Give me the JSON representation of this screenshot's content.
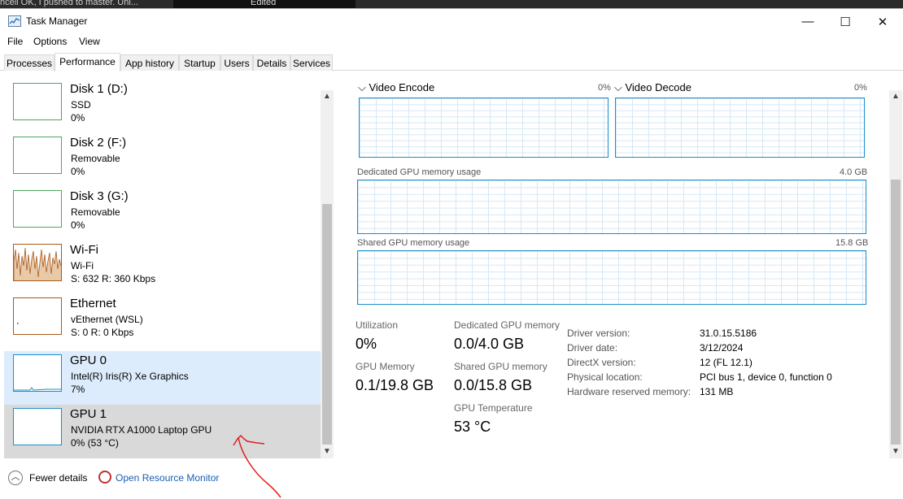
{
  "topstrip": {
    "text": "ncell OK, I pushed to master. Uni..."
  },
  "window": {
    "title": "Task Manager",
    "min": "—",
    "max": "☐",
    "close": "✕"
  },
  "menu": [
    "File",
    "Options",
    "View"
  ],
  "tabs": [
    "Processes",
    "Performance",
    "App history",
    "Startup",
    "Users",
    "Details",
    "Services"
  ],
  "sidebar": [
    {
      "name": "Disk 1 (D:)",
      "sub1": "SSD",
      "sub2": "0%"
    },
    {
      "name": "Disk 2 (F:)",
      "sub1": "Removable",
      "sub2": "0%"
    },
    {
      "name": "Disk 3 (G:)",
      "sub1": "Removable",
      "sub2": "0%"
    },
    {
      "name": "Wi-Fi",
      "sub1": "Wi-Fi",
      "sub2": "S: 632  R: 360 Kbps"
    },
    {
      "name": "Ethernet",
      "sub1": "vEthernet (WSL)",
      "sub2": "S: 0  R: 0 Kbps"
    },
    {
      "name": "GPU 0",
      "sub1": "Intel(R) Iris(R) Xe Graphics",
      "sub2": "7%"
    },
    {
      "name": "GPU 1",
      "sub1": "NVIDIA RTX A1000 Laptop GPU",
      "sub2": "0% (53 °C)"
    }
  ],
  "graphs": {
    "video_encode": {
      "label": "Video Encode",
      "value": "0%"
    },
    "video_decode": {
      "label": "Video Decode",
      "value": "0%"
    },
    "dedicated": {
      "label": "Dedicated GPU memory usage",
      "value": "4.0 GB"
    },
    "shared": {
      "label": "Shared GPU memory usage",
      "value": "15.8 GB"
    }
  },
  "stats": {
    "utilization": {
      "label": "Utilization",
      "value": "0%"
    },
    "gpu_memory": {
      "label": "GPU Memory",
      "value": "0.1/19.8 GB"
    },
    "dedicated_memory": {
      "label": "Dedicated GPU memory",
      "value": "0.0/4.0 GB"
    },
    "shared_memory": {
      "label": "Shared GPU memory",
      "value": "0.0/15.8 GB"
    },
    "temperature": {
      "label": "GPU Temperature",
      "value": "53 °C"
    }
  },
  "details": [
    {
      "key": "Driver version:",
      "value": "31.0.15.5186"
    },
    {
      "key": "Driver date:",
      "value": "3/12/2024"
    },
    {
      "key": "DirectX version:",
      "value": "12 (FL 12.1)"
    },
    {
      "key": "Physical location:",
      "value": "PCI bus 1, device 0, function 0"
    },
    {
      "key": "Hardware reserved memory:",
      "value": "131 MB"
    }
  ],
  "footer": {
    "fewer_details": "Fewer details",
    "resource_monitor": "Open Resource Monitor"
  },
  "colors": {
    "accent": "#1a8fc9",
    "disk_green": "#4da75a",
    "wifi_orange": "#a85a1a",
    "annotation_red": "#e02020"
  }
}
